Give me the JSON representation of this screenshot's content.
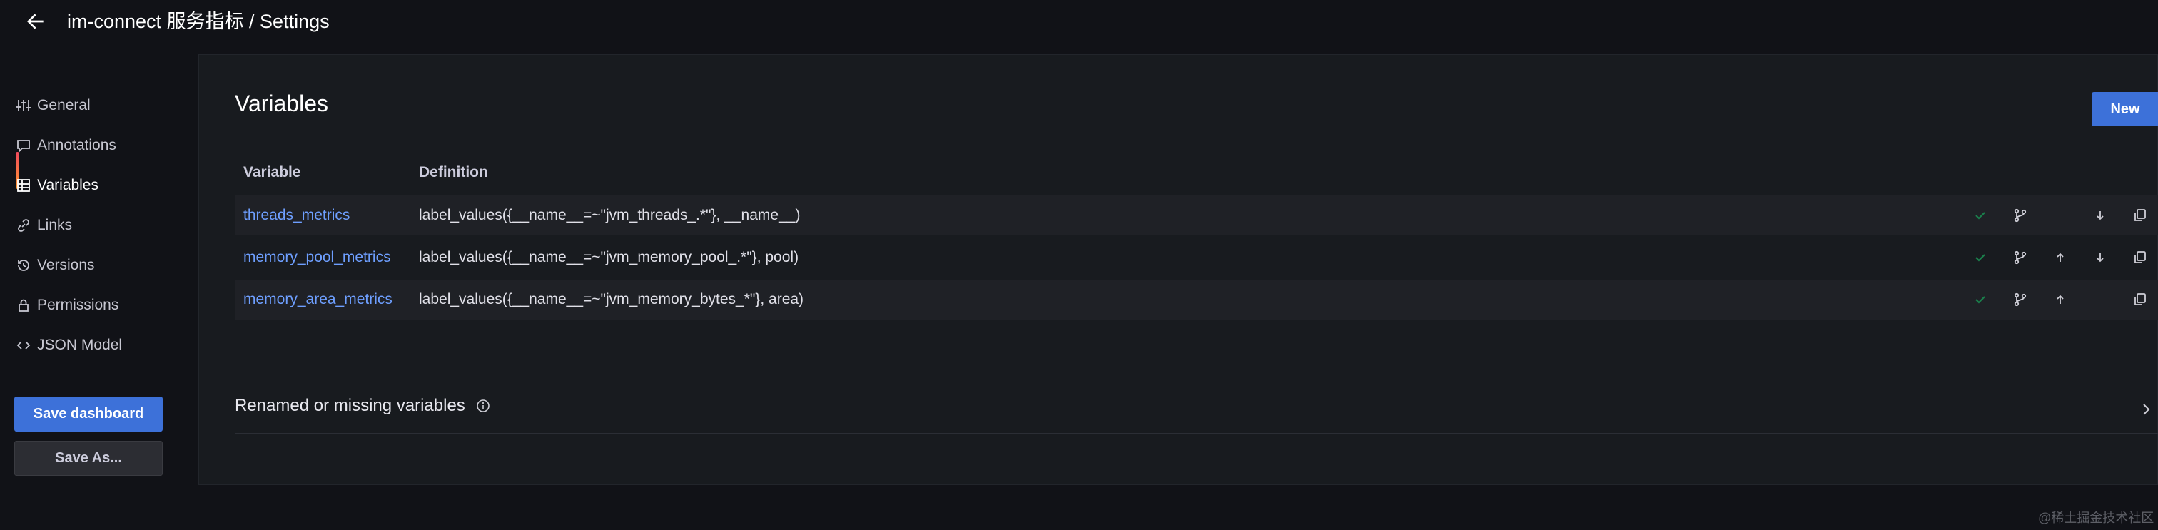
{
  "header": {
    "title": "im-connect 服务指标 / Settings"
  },
  "sidebar": {
    "items": [
      {
        "label": "General",
        "icon": "sliders-icon"
      },
      {
        "label": "Annotations",
        "icon": "comment-icon"
      },
      {
        "label": "Variables",
        "icon": "table-icon"
      },
      {
        "label": "Links",
        "icon": "link-icon"
      },
      {
        "label": "Versions",
        "icon": "history-icon"
      },
      {
        "label": "Permissions",
        "icon": "lock-icon"
      },
      {
        "label": "JSON Model",
        "icon": "code-icon"
      }
    ],
    "active_item": "Variables",
    "save_label": "Save dashboard",
    "save_as_label": "Save As..."
  },
  "main": {
    "title": "Variables",
    "new_label": "New",
    "columns": [
      "Variable",
      "Definition"
    ],
    "rows": [
      {
        "name": "threads_metrics",
        "definition": "label_values({__name__=~\"jvm_threads_.*\"}, __name__)"
      },
      {
        "name": "memory_pool_metrics",
        "definition": "label_values({__name__=~\"jvm_memory_pool_.*\"}, pool)"
      },
      {
        "name": "memory_area_metrics",
        "definition": "label_values({__name__=~\"jvm_memory_bytes_*\"}, area)"
      }
    ],
    "renamed_label": "Renamed or missing variables"
  },
  "watermark": "@稀土掘金技术社区",
  "colors": {
    "accent": "#3d71d9",
    "link": "#6e9fff",
    "check": "#1a7f4b",
    "active_bar": "#ff9830"
  }
}
